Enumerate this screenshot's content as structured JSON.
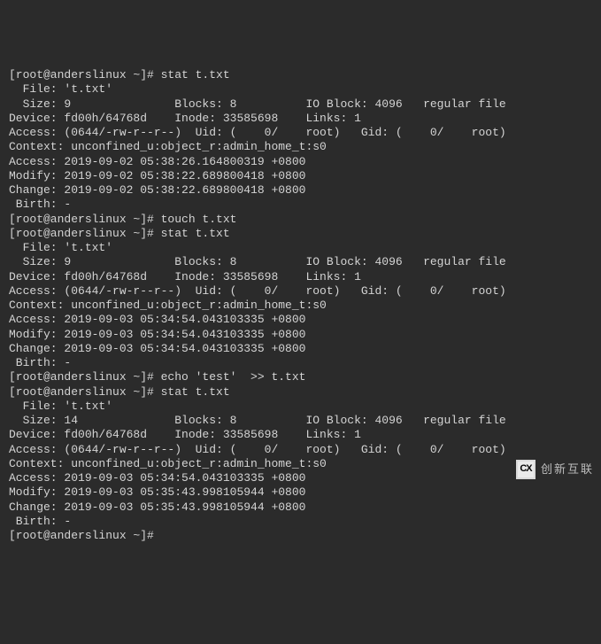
{
  "lines": [
    "[root@anderslinux ~]# stat t.txt",
    "  File: 't.txt'",
    "  Size: 9               Blocks: 8          IO Block: 4096   regular file",
    "Device: fd00h/64768d    Inode: 33585698    Links: 1",
    "Access: (0644/-rw-r--r--)  Uid: (    0/    root)   Gid: (    0/    root)",
    "Context: unconfined_u:object_r:admin_home_t:s0",
    "Access: 2019-09-02 05:38:26.164800319 +0800",
    "Modify: 2019-09-02 05:38:22.689800418 +0800",
    "Change: 2019-09-02 05:38:22.689800418 +0800",
    " Birth: -",
    "[root@anderslinux ~]# touch t.txt",
    "[root@anderslinux ~]# stat t.txt",
    "  File: 't.txt'",
    "  Size: 9               Blocks: 8          IO Block: 4096   regular file",
    "Device: fd00h/64768d    Inode: 33585698    Links: 1",
    "Access: (0644/-rw-r--r--)  Uid: (    0/    root)   Gid: (    0/    root)",
    "Context: unconfined_u:object_r:admin_home_t:s0",
    "Access: 2019-09-03 05:34:54.043103335 +0800",
    "Modify: 2019-09-03 05:34:54.043103335 +0800",
    "Change: 2019-09-03 05:34:54.043103335 +0800",
    " Birth: -",
    "[root@anderslinux ~]# echo 'test'  >> t.txt",
    "[root@anderslinux ~]# stat t.txt",
    "  File: 't.txt'",
    "  Size: 14              Blocks: 8          IO Block: 4096   regular file",
    "Device: fd00h/64768d    Inode: 33585698    Links: 1",
    "Access: (0644/-rw-r--r--)  Uid: (    0/    root)   Gid: (    0/    root)",
    "Context: unconfined_u:object_r:admin_home_t:s0",
    "Access: 2019-09-03 05:34:54.043103335 +0800",
    "Modify: 2019-09-03 05:35:43.998105944 +0800",
    "Change: 2019-09-03 05:35:43.998105944 +0800",
    " Birth: -",
    "[root@anderslinux ~]# "
  ],
  "watermark": {
    "logo": "CX",
    "text": "创新互联"
  }
}
